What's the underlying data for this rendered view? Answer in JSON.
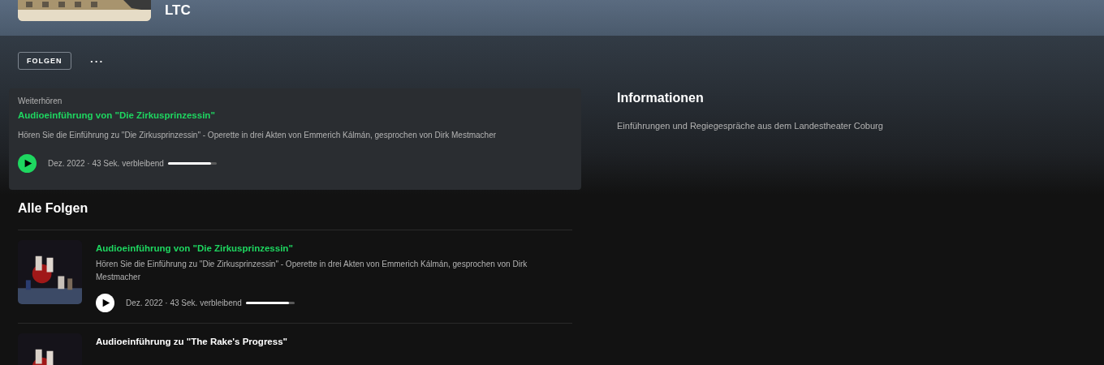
{
  "show": {
    "title": "LTC"
  },
  "actions": {
    "follow_button": "FOLGEN",
    "more_button": "•••"
  },
  "continue_listening": {
    "label": "Weiterhören",
    "title": "Audioeinführung von \"Die Zirkusprinzessin\"",
    "description": "Hören Sie die Einführung zu \"Die Zirkusprinzessin\" - Operette in drei Akten von Emmerich Kálmán, gesprochen von Dirk Mestmacher",
    "meta": "Dez. 2022 · 43 Sek. verbleibend",
    "level": 0.88
  },
  "episodes_heading": "Alle Folgen",
  "episodes": [
    {
      "title": "Audioeinführung von \"Die Zirkusprinzessin\"",
      "current": true,
      "description": "Hören Sie die Einführung zu \"Die Zirkusprinzessin\" - Operette in drei Akten von Emmerich Kálmán, gesprochen von Dirk Mestmacher",
      "meta": "Dez. 2022 · 43 Sek. verbleibend",
      "level": 0.88
    },
    {
      "title": "Audioeinführung zu \"The Rake's Progress\"",
      "current": false
    }
  ],
  "info": {
    "heading": "Informationen",
    "text": "Einführungen und Regiegespräche aus dem Landestheater Coburg"
  }
}
